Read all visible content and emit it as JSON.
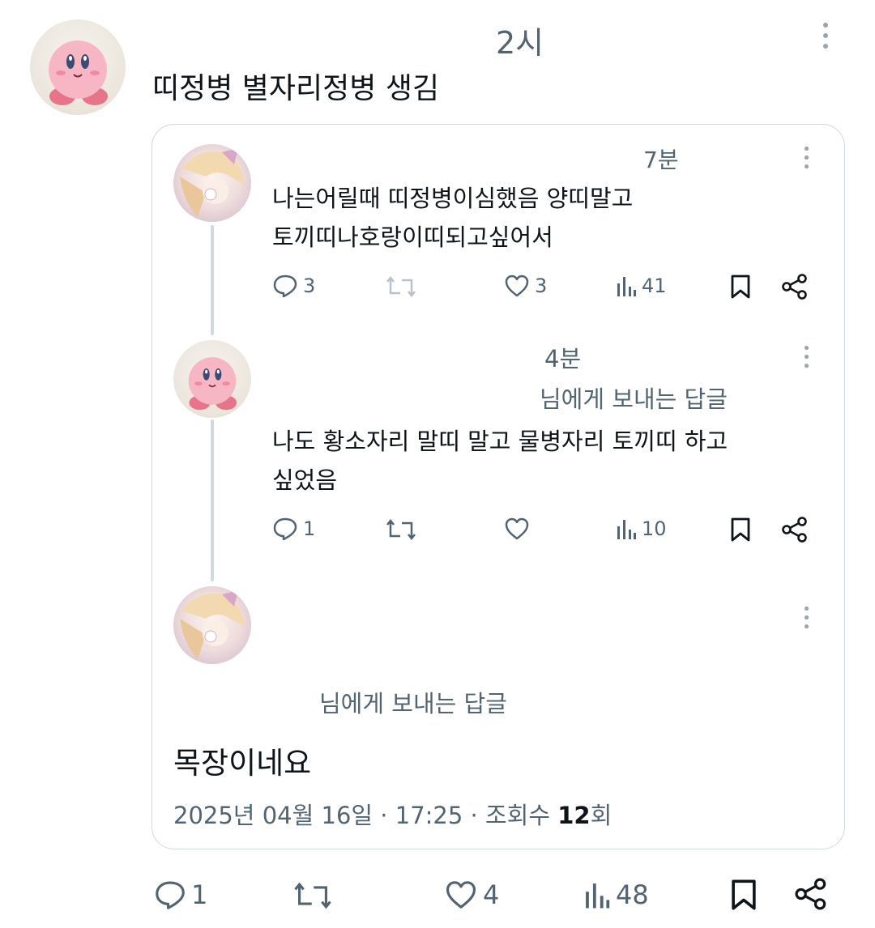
{
  "main_tweet": {
    "time": "2시",
    "text": "띠정병 별자리정병 생김",
    "actions": {
      "replies": "1",
      "retweets": "",
      "likes": "4",
      "views": "48"
    }
  },
  "quoted": {
    "reply1": {
      "time": "7분",
      "line1": "나는어릴때 띠정병이심했음 양띠말고",
      "line2": "토끼띠나호랑이띠되고싶어서",
      "actions": {
        "replies": "3",
        "retweets": "",
        "likes": "3",
        "views": "41"
      }
    },
    "reply2": {
      "time": "4분",
      "reply_to": "님에게 보내는 답글",
      "line1": "나도 황소자리 말띠 말고 물병자리 토끼띠 하고",
      "line2": "싶었음",
      "actions": {
        "replies": "1",
        "retweets": "",
        "likes": "",
        "views": "10"
      }
    },
    "reply3": {
      "reply_to": "님에게 보내는 답글",
      "text": "목장이네요",
      "meta_prefix": "2025년 04월 16일 · 17:25 · 조회수 ",
      "meta_count": "12",
      "meta_suffix": "회"
    }
  },
  "colors": {
    "muted": "#536471",
    "border": "#cfd9de",
    "text": "#0f1419"
  },
  "icons": [
    "reply-icon",
    "retweet-icon",
    "like-icon",
    "views-icon",
    "bookmark-icon",
    "share-icon",
    "more-icon"
  ]
}
